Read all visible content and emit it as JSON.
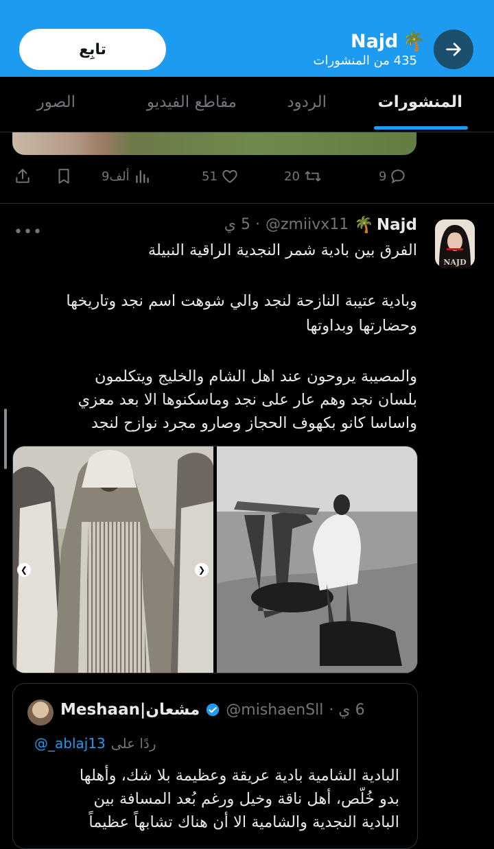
{
  "header": {
    "follow_label": "تابِع",
    "profile_name": "Najd",
    "post_count": "435 من المنشورات",
    "palm_emoji": "🌴",
    "accent": "#1d9bf0"
  },
  "tabs": [
    {
      "label": "المنشورات",
      "active": true
    },
    {
      "label": "الردود",
      "active": false
    },
    {
      "label": "مقاطع الفيديو",
      "active": false
    },
    {
      "label": "الصور",
      "active": false
    }
  ],
  "prev_actions": {
    "replies": "9",
    "reposts": "20",
    "likes": "51",
    "views": "9ألف"
  },
  "tweet": {
    "name": "Najd",
    "palm_emoji": "🌴",
    "handle": "@zmiivx11",
    "time": "· 5 ي",
    "avatar_text": "NAJD",
    "lines": [
      "الفرق بين بادية شمر النجدية الراقية النبيلة",
      "",
      "وبادية عتيبة النازحة لنجد والي شوهت اسم نجد وتاريخها",
      "وحضارتها وبداوتها",
      "",
      "والمصيبة يروحون عند اهل الشام والخليج ويتكلمون",
      "بلسان نجد وهم عار على نجد وماسكنوها الا بعد معزي",
      "واساسا كانو بكهوف الحجاز وصارو مجرد نوازح لنجد"
    ]
  },
  "quote": {
    "name": "Meshaan|مشعان",
    "handle": "@mishaenSll",
    "time": "6 ي ·",
    "reply_prefix": "ردًا على",
    "reply_handle": "@_ablaj13",
    "lines": [
      "البادية الشامية بادية عريقة وعظيمة بلا شك، وأهلها",
      "بدو خُلّص، أهل ناقة وخيل ورغم بُعد المسافة بين",
      "البادية النجدية والشامية الا أن هناك تشابهاً عظيماً"
    ]
  }
}
